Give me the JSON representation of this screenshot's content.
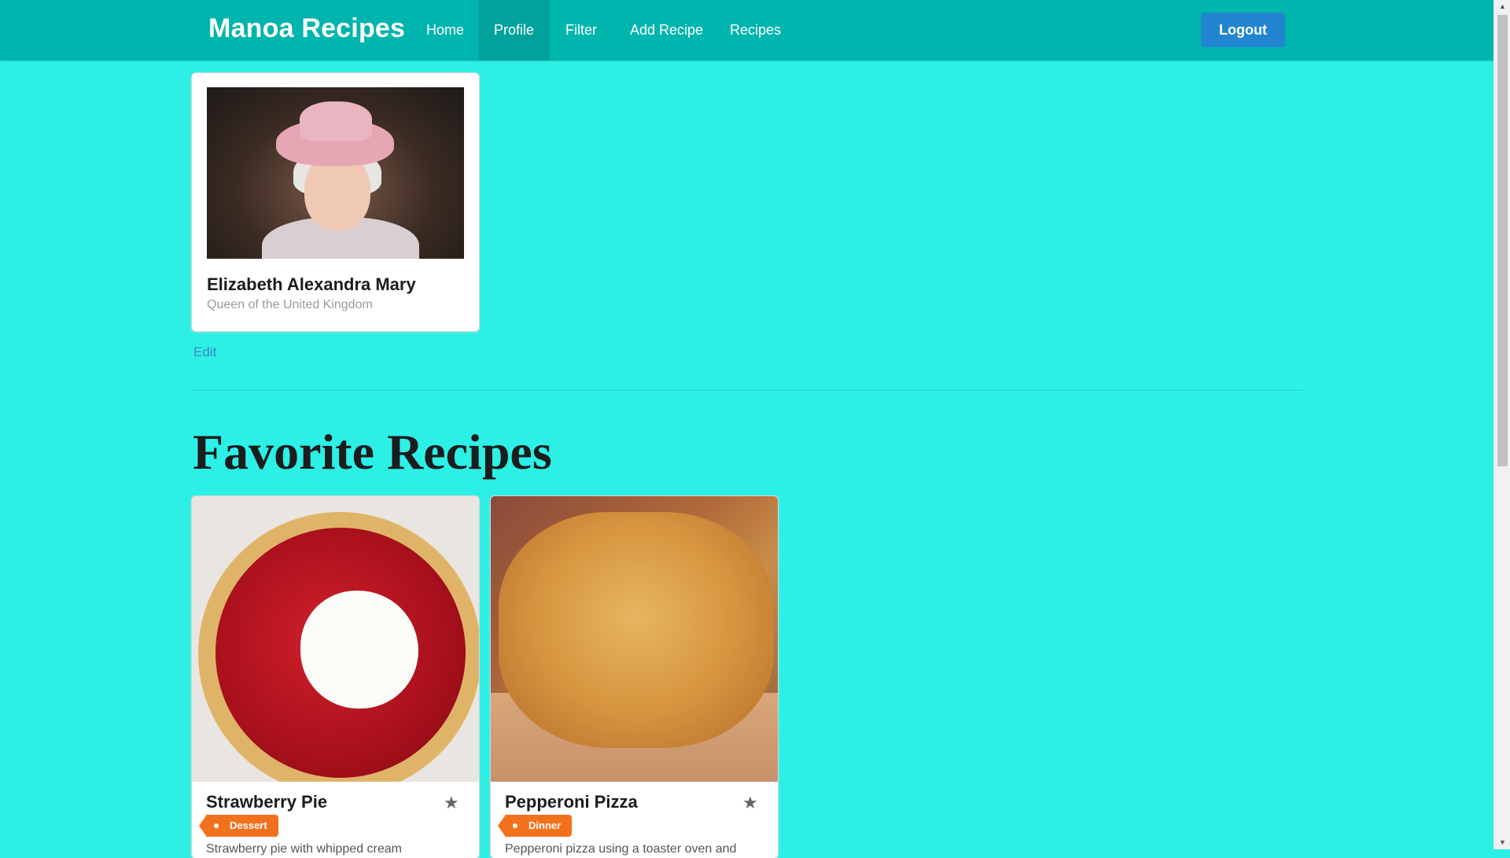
{
  "menu": {
    "brand": "Manoa Recipes",
    "items": [
      {
        "label": "Home",
        "active": false
      },
      {
        "label": "Profile",
        "active": true
      },
      {
        "label": "Filter",
        "active": false
      },
      {
        "label": "Add Recipe",
        "active": false
      },
      {
        "label": "Recipes",
        "active": false
      }
    ],
    "logout_label": "Logout"
  },
  "profile": {
    "photo_icon": "profile-photo",
    "name": "Elizabeth Alexandra Mary",
    "title": "Queen of the United Kingdom",
    "edit_label": "Edit"
  },
  "favorites": {
    "heading": "Favorite Recipes",
    "recipes": [
      {
        "name": "Strawberry Pie",
        "tag": "Dessert",
        "description": "Strawberry pie with whipped cream",
        "favorite_icon": "star-icon"
      },
      {
        "name": "Pepperoni Pizza",
        "tag": "Dinner",
        "description": "Pepperoni pizza using a toaster oven and",
        "favorite_icon": "star-icon"
      }
    ]
  },
  "colors": {
    "page_background": "#2cf0e6",
    "menu_background": "#00b5ad",
    "logout_button": "#2185d0",
    "tag": "#f2711c",
    "link": "#4183c4"
  }
}
